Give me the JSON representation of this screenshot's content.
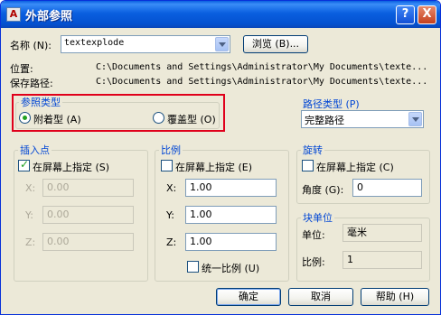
{
  "window": {
    "title": "外部参照",
    "icon_name": "autocad-app-icon",
    "help_glyph": "?",
    "close_glyph": "X"
  },
  "name_row": {
    "label": "名称 (N):",
    "value": "textexplode",
    "browse_label": "浏览 (B)..."
  },
  "location": {
    "label": "位置:",
    "value": "C:\\Documents and Settings\\Administrator\\My Documents\\texte..."
  },
  "saved_path": {
    "label": "保存路径:",
    "value": "C:\\Documents and Settings\\Administrator\\My Documents\\texte..."
  },
  "reference_type": {
    "title": "参照类型",
    "attach_label": "附着型 (A)",
    "overlay_label": "覆盖型 (O)",
    "selected": "attach"
  },
  "path_type": {
    "title": "路径类型 (P)",
    "value": "完整路径"
  },
  "insertion_point": {
    "title": "插入点",
    "specify_label": "在屏幕上指定 (S)",
    "specify_checked": true,
    "x_label": "X:",
    "x_value": "0.00",
    "y_label": "Y:",
    "y_value": "0.00",
    "z_label": "Z:",
    "z_value": "0.00"
  },
  "scale": {
    "title": "比例",
    "specify_label": "在屏幕上指定 (E)",
    "specify_checked": false,
    "x_label": "X:",
    "x_value": "1.00",
    "y_label": "Y:",
    "y_value": "1.00",
    "z_label": "Z:",
    "z_value": "1.00",
    "uniform_label": "统一比例 (U)",
    "uniform_checked": false
  },
  "rotation": {
    "title": "旋转",
    "specify_label": "在屏幕上指定 (C)",
    "specify_checked": false,
    "angle_label": "角度 (G):",
    "angle_value": "0"
  },
  "block_unit": {
    "title": "块单位",
    "unit_label": "单位:",
    "unit_value": "毫米",
    "factor_label": "比例:",
    "factor_value": "1"
  },
  "buttons": {
    "ok": "确定",
    "cancel": "取消",
    "help": "帮助 (H)"
  },
  "colors": {
    "title_bar": "#0a5fe0",
    "dialog_bg": "#ece9d8",
    "group_title": "#0046d5",
    "highlight_box": "#e0001b",
    "check_mark": "#21a121"
  }
}
